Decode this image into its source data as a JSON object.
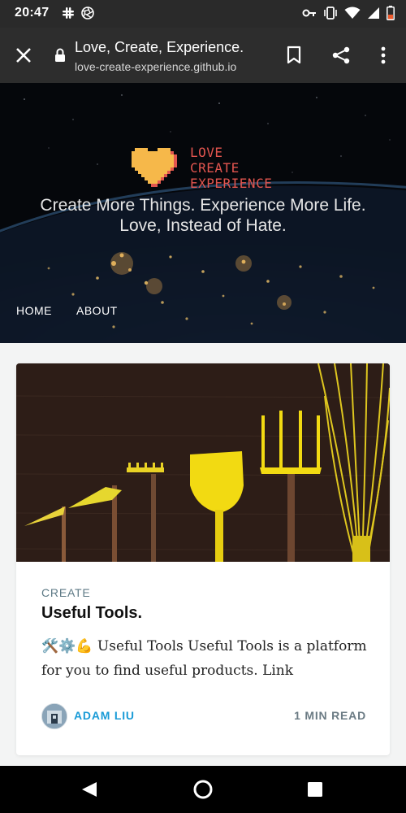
{
  "status": {
    "time": "20:47"
  },
  "browser": {
    "title": "Love, Create, Experience.",
    "url": "love-create-experience.github.io"
  },
  "hero": {
    "logo_lines": [
      "LOVE",
      "CREATE",
      "EXPERIENCE"
    ],
    "tagline_line1": "Create More Things. Experience More Life.",
    "tagline_line2": "Love, Instead of Hate.",
    "nav": [
      "HOME",
      "ABOUT"
    ]
  },
  "post": {
    "category": "CREATE",
    "title": "Useful Tools.",
    "excerpt": "🛠️⚙️💪 Useful Tools Useful Tools is a platform for you to find useful products. Link",
    "author": "ADAM LIU",
    "read_time": "1 MIN READ"
  },
  "colors": {
    "logo_red": "#e2554f",
    "logo_heart": "#f6b84a",
    "author_blue": "#1a9bd7",
    "tool_yellow": "#f2da12"
  },
  "icons": [
    "slack-icon",
    "aperture-icon",
    "key-icon",
    "vibrate-icon",
    "wifi-icon",
    "battery-icon",
    "close-icon",
    "lock-icon",
    "bookmark-icon",
    "share-icon",
    "more-icon",
    "back-icon",
    "home-icon",
    "recents-icon"
  ]
}
